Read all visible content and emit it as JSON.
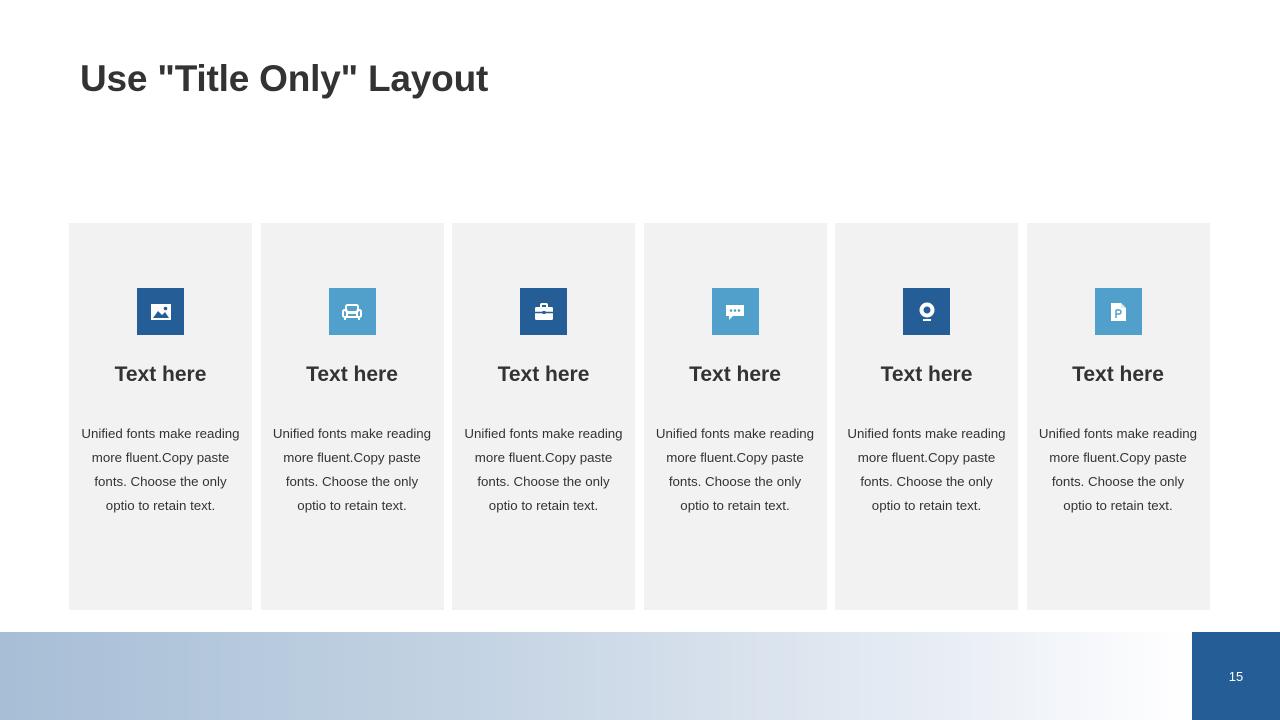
{
  "title": "Use \"Title Only\" Layout",
  "cards": [
    {
      "icon": "image-icon",
      "heading": "Text here",
      "lines": [
        "Unified  fonts make reading",
        "more fluent.Copy paste",
        "fonts. Choose the only",
        "optio to retain text."
      ]
    },
    {
      "icon": "sofa-icon",
      "heading": "Text here",
      "lines": [
        "Unified  fonts make reading",
        "more fluent.Copy paste",
        "fonts. Choose the only",
        "optio to retain text."
      ]
    },
    {
      "icon": "briefcase-icon",
      "heading": "Text here",
      "lines": [
        "Unified  fonts make reading",
        "more fluent.Copy paste",
        "fonts. Choose the only",
        "optio to retain text."
      ]
    },
    {
      "icon": "chat-bubble-icon",
      "heading": "Text here",
      "lines": [
        "Unified  fonts make reading",
        "more fluent.Copy paste",
        "fonts. Choose the only",
        "optio to retain text."
      ]
    },
    {
      "icon": "webcam-icon",
      "heading": "Text here",
      "lines": [
        "Unified  fonts make reading",
        "more fluent.Copy paste",
        "fonts. Choose the only",
        "optio to retain text."
      ]
    },
    {
      "icon": "powerpoint-file-icon",
      "heading": "Text here",
      "lines": [
        "Unified  fonts make reading",
        "more fluent.Copy paste",
        "fonts. Choose the only",
        "optio to retain text."
      ]
    }
  ],
  "page_number": "15",
  "colors": {
    "dark_blue": "#255e97",
    "light_blue": "#519fcb",
    "card_bg": "#f2f2f2",
    "text": "#333333"
  }
}
